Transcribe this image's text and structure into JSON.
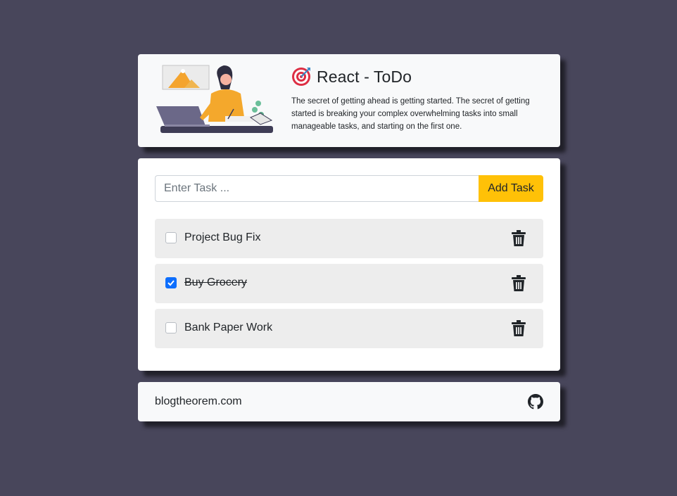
{
  "header": {
    "title": "React - ToDo",
    "tagline": "The secret of getting ahead is getting started. The secret of getting started is breaking your complex overwhelming tasks into small manageable tasks, and starting on the first one.",
    "icon": "direct-hit-target-icon",
    "illustration": "woman-working-at-laptop-illustration"
  },
  "form": {
    "placeholder": "Enter Task ...",
    "value": "",
    "add_label": "Add Task"
  },
  "tasks": [
    {
      "label": "Project Bug Fix",
      "completed": false
    },
    {
      "label": "Buy Grocery",
      "completed": true
    },
    {
      "label": "Bank Paper Work",
      "completed": false
    }
  ],
  "footer": {
    "text": "blogtheorem.com",
    "icon": "github-icon"
  },
  "colors": {
    "background": "#48465b",
    "accent": "#ffc107",
    "check": "#0d6efd",
    "task_bg": "#ededed"
  }
}
